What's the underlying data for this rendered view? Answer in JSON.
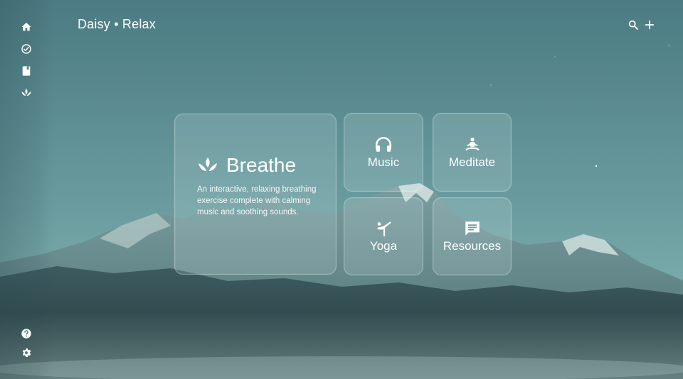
{
  "app": {
    "title": "Daisy • Relax"
  },
  "sidebar": {
    "top_icons": [
      "home-icon",
      "check-circle-icon",
      "journal-icon",
      "lotus-icon"
    ],
    "bottom_icons": [
      "help-icon",
      "gear-icon"
    ]
  },
  "header": {
    "actions": [
      "search-icon",
      "add-icon"
    ]
  },
  "cards": {
    "breathe": {
      "title": "Breathe",
      "description": "An interactive, relaxing breathing exercise complete with calming music and soothing sounds.",
      "icon": "lotus-icon"
    },
    "music": {
      "label": "Music",
      "icon": "headphones-icon"
    },
    "meditate": {
      "label": "Meditate",
      "icon": "meditation-icon"
    },
    "yoga": {
      "label": "Yoga",
      "icon": "yoga-icon"
    },
    "resources": {
      "label": "Resources",
      "icon": "chat-icon"
    }
  },
  "colors": {
    "sky_top": "#4f7f86",
    "sky_bottom": "#7eb0b0",
    "mountain_dark": "#2f4c50",
    "snow": "#c9d9d8"
  }
}
